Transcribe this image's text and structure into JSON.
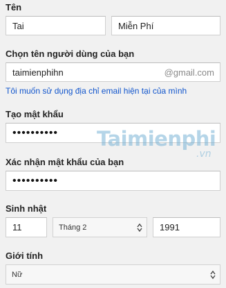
{
  "form": {
    "name_label": "Tên",
    "first_name_value": "Tai",
    "last_name_value": "Miễn Phí",
    "username_label": "Chọn tên người dùng của bạn",
    "username_value": "taimienphihn",
    "username_suffix": "@gmail.com",
    "use_current_email_link": "Tôi muốn sử dụng địa chỉ email hiện tại của mình",
    "password_label": "Tạo mật khẩu",
    "password_mask": "••••••••••",
    "confirm_label": "Xác nhận mật khẩu của bạn",
    "confirm_mask": "••••••••••",
    "birthday_label": "Sinh nhật",
    "birth_day_value": "11",
    "birth_month_value": "Tháng 2",
    "birth_year_value": "1991",
    "gender_label": "Giới tính",
    "gender_value": "Nữ"
  },
  "watermark": {
    "main": "Taimienphi",
    "suffix": ".vn"
  },
  "colors": {
    "link": "#1155cc",
    "background": "#f1f1f1",
    "input_border": "#cfcfcf"
  }
}
